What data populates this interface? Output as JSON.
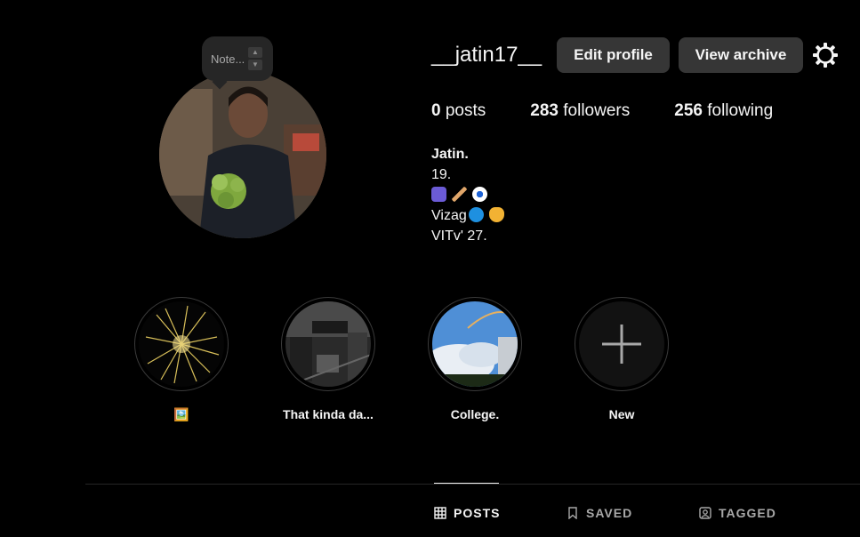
{
  "profile": {
    "username": "__jatin17__",
    "edit_label": "Edit profile",
    "archive_label": "View archive",
    "note_placeholder": "Note...",
    "stats": {
      "posts_count": "0",
      "posts_label": "posts",
      "followers_count": "283",
      "followers_label": "followers",
      "following_count": "256",
      "following_label": "following"
    },
    "bio": {
      "name": "Jatin.",
      "line1": "19.",
      "line2_icons": [
        "gamepad-emoji",
        "cricket-emoji",
        "soccer-ball-emoji"
      ],
      "line3": "Vizag",
      "line3_icons": [
        "wave-emoji",
        "heart-hands-emoji"
      ],
      "line4": "VITv' 27."
    }
  },
  "highlights": [
    {
      "label": "🖼️",
      "icon": "fireworks-image"
    },
    {
      "label": "That kinda da...",
      "icon": "bw-street-image"
    },
    {
      "label": "College.",
      "icon": "sky-rainbow-image"
    },
    {
      "label": "New",
      "icon": "plus-icon"
    }
  ],
  "tabs": [
    {
      "label": "POSTS",
      "icon": "grid-icon",
      "active": true
    },
    {
      "label": "SAVED",
      "icon": "bookmark-icon",
      "active": false
    },
    {
      "label": "TAGGED",
      "icon": "tag-person-icon",
      "active": false
    }
  ],
  "colors": {
    "background": "#000000",
    "button_bg": "#363636",
    "text_primary": "#f5f5f5",
    "text_secondary": "#a8a8a8"
  }
}
